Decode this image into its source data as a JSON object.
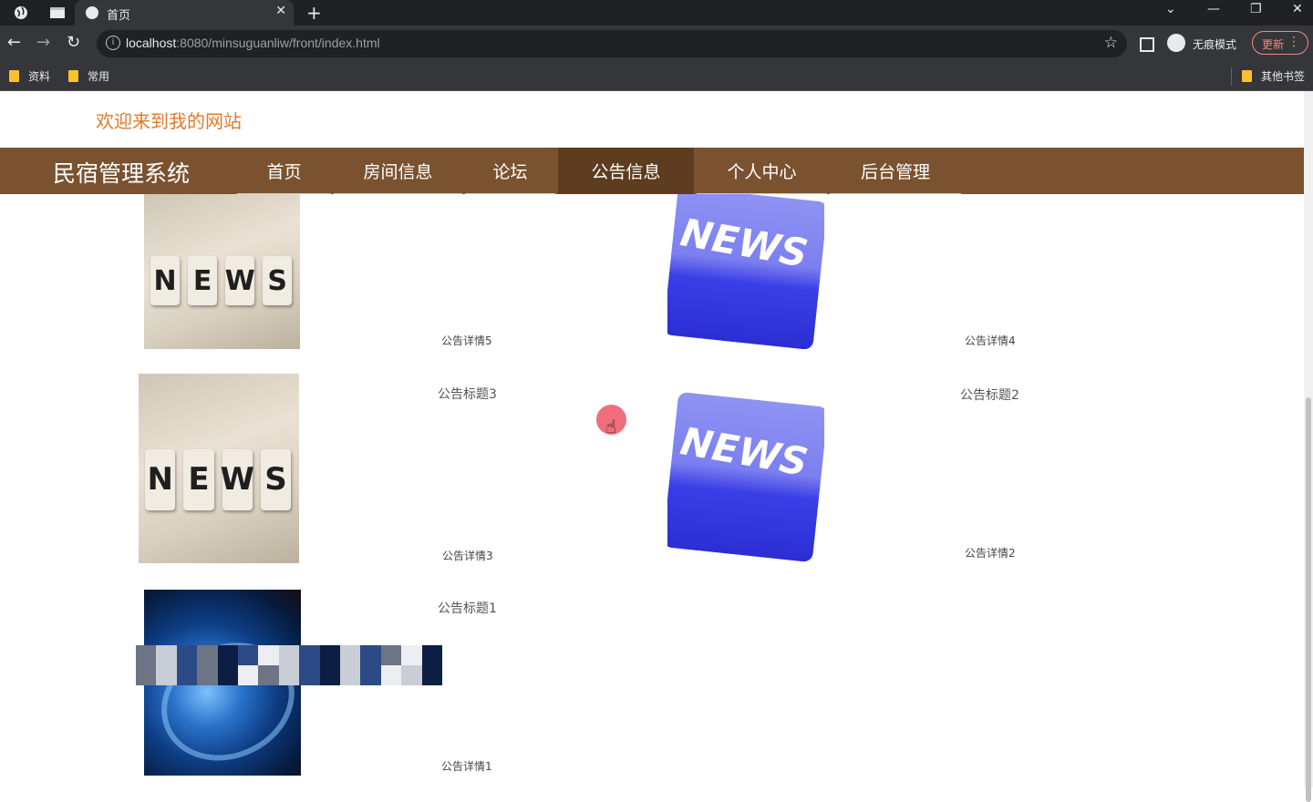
{
  "browser": {
    "tab_title": "首页",
    "close_glyph": "✕",
    "newtab_glyph": "+",
    "url_host": "localhost",
    "url_rest": ":8080/minsuguanliw/front/index.html",
    "incognito_label": "无痕模式",
    "update_label": "更新",
    "bookmarks": [
      "资料",
      "常用"
    ],
    "other_bookmarks": "其他书签"
  },
  "page": {
    "welcome": "欢迎来到我的网站",
    "brand": "民宿管理系统",
    "nav": [
      "首页",
      "房间信息",
      "论坛",
      "公告信息",
      "个人中心",
      "后台管理"
    ],
    "active_nav": "公告信息"
  },
  "notices": [
    {
      "title": "",
      "detail": "公告详情5",
      "image": "news-cubes"
    },
    {
      "title": "",
      "detail": "公告详情4",
      "image": "news-key"
    },
    {
      "title": "公告标题3",
      "detail": "公告详情3",
      "image": "news-cubes"
    },
    {
      "title": "公告标题2",
      "detail": "公告详情2",
      "image": "news-key"
    },
    {
      "title": "公告标题1",
      "detail": "公告详情1",
      "image": "globe"
    }
  ],
  "news_word": "NEWS",
  "colors": {
    "nav_bg": "#7a5230",
    "nav_active": "#5e3c1f",
    "welcome": "#e07a2a"
  }
}
